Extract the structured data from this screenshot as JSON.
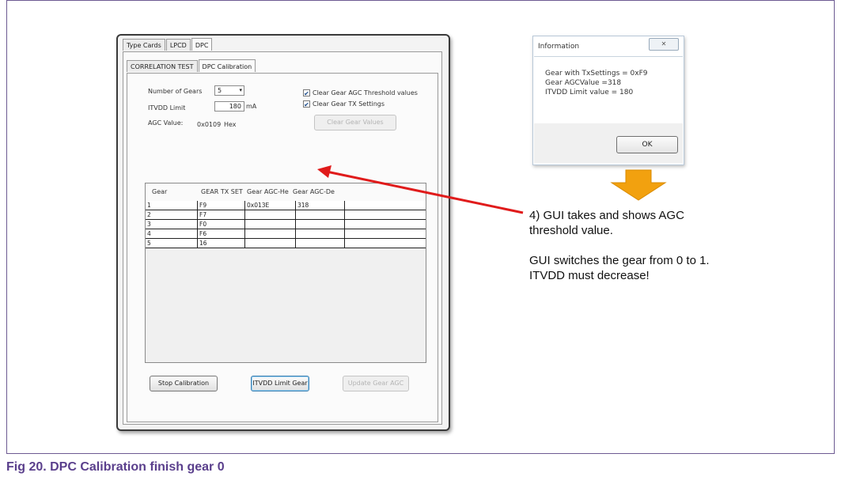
{
  "outer_tabs": [
    "Type Cards",
    "LPCD",
    "DPC"
  ],
  "inner_tabs": [
    "CORRELATION TEST",
    "DPC Calibration"
  ],
  "form": {
    "gears_label": "Number of Gears",
    "gears_value": "5",
    "itvdd_label": "ITVDD Limit",
    "itvdd_value": "180",
    "itvdd_unit": "mA",
    "agc_label": "AGC Value:",
    "agc_value": "0x0109",
    "agc_unit": "Hex",
    "clear_threshold_label": "Clear Gear AGC Threshold values",
    "clear_threshold_checked": true,
    "clear_tx_label": "Clear Gear TX Settings",
    "clear_tx_checked": true,
    "clear_button": "Clear Gear Values"
  },
  "grid": {
    "columns": [
      "Gear",
      "GEAR TX SET",
      "Gear AGC-He",
      "Gear AGC-De"
    ],
    "rows": [
      [
        "1",
        "F9",
        "0x013E",
        "318"
      ],
      [
        "2",
        "F7",
        "",
        ""
      ],
      [
        "3",
        "F0",
        "",
        ""
      ],
      [
        "4",
        "F6",
        "",
        ""
      ],
      [
        "5",
        "16",
        "",
        ""
      ]
    ]
  },
  "buttons": {
    "stop": "Stop Calibration",
    "itvdd_limit_gear": "ITVDD Limit Gear",
    "update": "Update Gear AGC"
  },
  "info_dialog": {
    "title": "Information",
    "close": "✕",
    "line1": "Gear with TxSettings = 0xF9",
    "line2": "Gear AGCValue =318",
    "line3": "ITVDD Limit value = 180",
    "ok": "OK"
  },
  "annotation": {
    "line1": "4) GUI takes and shows AGC",
    "line2": "threshold value.",
    "line3": "GUI switches the gear from 0 to 1.",
    "line4": "ITVDD must decrease!"
  },
  "caption": "Fig 20.   DPC Calibration finish gear 0",
  "colors": {
    "arrow": "#e01b1b",
    "down_arrow": "#f2a10f",
    "caption": "#5a3f8c"
  }
}
